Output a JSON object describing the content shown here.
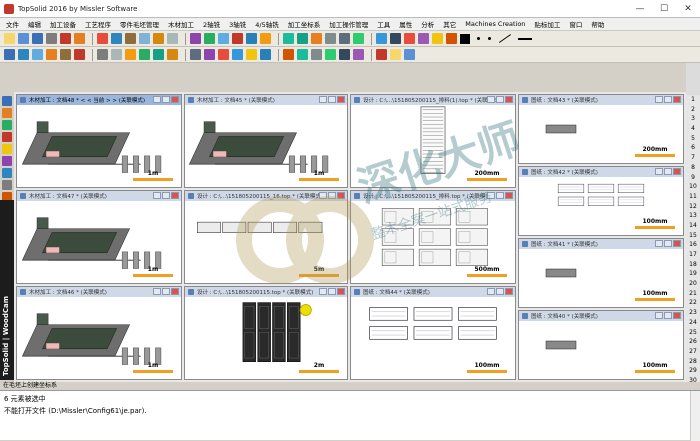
{
  "app": {
    "title": "TopSolid 2016 by Missler Software",
    "win_controls": [
      "—",
      "☐",
      "✕"
    ]
  },
  "menu": [
    "文件",
    "编辑",
    "加工设备",
    "工艺程序",
    "零件毛坯管理",
    "木材加工",
    "2轴铣",
    "3轴铣",
    "4/5轴铣",
    "加工坐标系",
    "加工操作管理",
    "工具",
    "属性",
    "分析",
    "其它",
    "Machines Creation",
    "贴标加工",
    "窗口",
    "帮助"
  ],
  "toolbar_colors": {
    "row1": [
      "#f5d76e",
      "#5b8fd6",
      "#3a6fb5",
      "#7d7d7d",
      "#c0392b",
      "#e67e22",
      "#e74c3c",
      "#2e86c1",
      "#8e6e3c",
      "#7fb3d5",
      "#d68910",
      "#aab7b8",
      "#8e44ad",
      "#27ae60",
      "#5dade2",
      "#c0392b",
      "#2980b9",
      "#f39c12",
      "#1abc9c",
      "#16a085",
      "#e67e22",
      "#7f8c8d",
      "#5d6d7e",
      "#2ecc71",
      "#3498db",
      "#34495e",
      "#e74c3c",
      "#9b59b6",
      "#f1c40f",
      "#d35400"
    ],
    "row2": [
      "#3a6fb5",
      "#2e86c1",
      "#5dade2",
      "#e67e22",
      "#8e6e3c",
      "#c0392b",
      "#7d7d7d",
      "#aab7b8",
      "#f39c12",
      "#27ae60",
      "#16a085",
      "#d68910",
      "#5d6d7e",
      "#8e44ad",
      "#e74c3c",
      "#3498db",
      "#f1c40f",
      "#2980b9",
      "#d35400",
      "#1abc9c",
      "#7f8c8d",
      "#2ecc71",
      "#34495e",
      "#9b59b6",
      "#c0392b",
      "#f5d76e",
      "#5b8fd6"
    ]
  },
  "sidebar": {
    "woodcam_label": "TopSolid | WoodCam"
  },
  "ruler_numbers": [
    "1",
    "2",
    "3",
    "4",
    "5",
    "6",
    "7",
    "8",
    "9",
    "10",
    "11",
    "12",
    "13",
    "14",
    "15",
    "16",
    "17",
    "18",
    "19",
    "20",
    "21",
    "22",
    "23",
    "24",
    "25",
    "26",
    "27",
    "28",
    "29",
    "30"
  ],
  "windows": [
    {
      "caption": "木材加工 : 文档48 *  < < 当前 > > (关联模式)",
      "scale": "1m",
      "active": true
    },
    {
      "caption": "木材加工 : 文档45 * (关联模式)",
      "scale": "1m",
      "active": false
    },
    {
      "caption": "设计 : C:\\...\\151805200115_排料(1).top * (关联模式)",
      "scale": "200mm",
      "active": false
    },
    {
      "caption": "图纸 : 文档43 * (关联模式)",
      "scale": "200mm",
      "active": false
    },
    {
      "caption": "木材加工 : 文档47 * (关联模式)",
      "scale": "1m",
      "active": false
    },
    {
      "caption": "设计 : C:\\...\\151805200115_16.top * (关联模式)",
      "scale": "5m",
      "active": false
    },
    {
      "caption": "设计 : C:\\...\\151805200115_排料.top * (关联模式)",
      "scale": "500mm",
      "active": false
    },
    {
      "caption": "图纸 : 文档42 * (关联模式)",
      "scale": "100mm",
      "active": false
    },
    {
      "caption": "木材加工 : 文档46 * (关联模式)",
      "scale": "1m",
      "active": false
    },
    {
      "caption": "设计 : C:\\...\\151805200115.top * (关联模式)",
      "scale": "2m",
      "active": false
    },
    {
      "caption": "图纸 : 文档44 * (关联模式)",
      "scale": "100mm",
      "active": false
    },
    {
      "caption": "图纸 : 文档41 * (关联模式)",
      "scale": "100mm",
      "active": false
    },
    {
      "caption": "图纸 : 文档40 * (关联模式)",
      "scale": "100mm",
      "active": false
    }
  ],
  "status": {
    "hint": "在毛坯上创建坐标系"
  },
  "console": {
    "line1": "6 元素被选中",
    "line2": "不能打开文件 (D:\\Missler\\Config61\\je.par)."
  },
  "watermark": {
    "main": "深化大师",
    "sub": "整木全案一站式服务"
  }
}
